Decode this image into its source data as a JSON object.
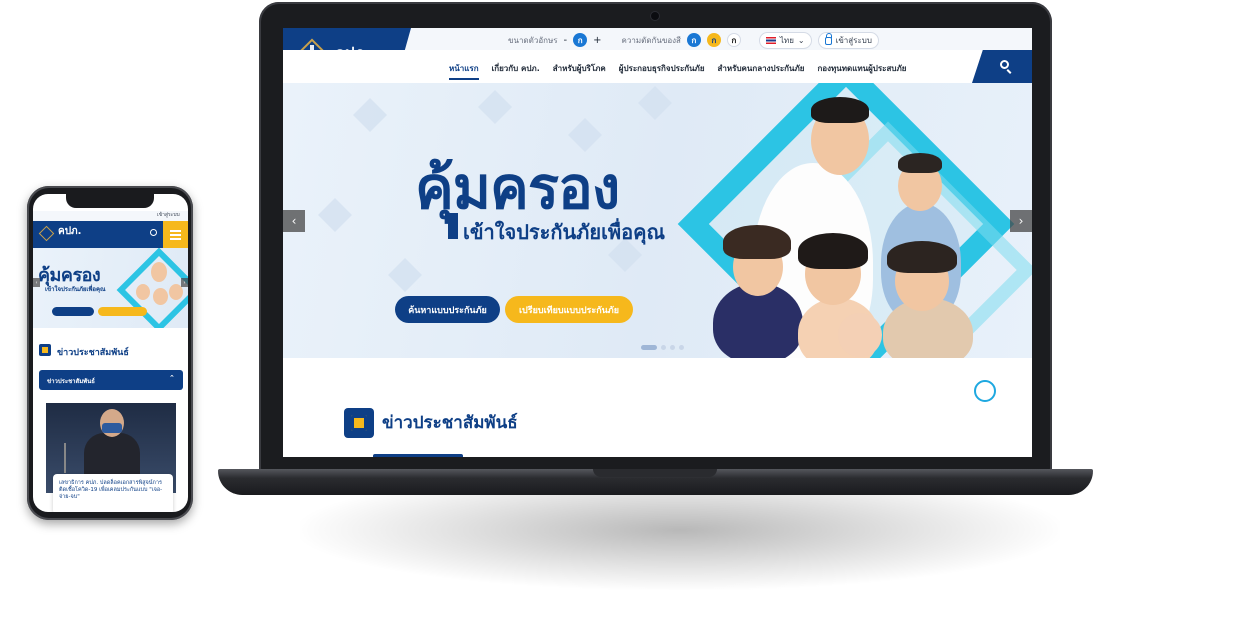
{
  "desktop": {
    "logo": {
      "title": "คปภ.",
      "subtitle": "สำนักงานคณะกรรมการกำกับและส่งเสริมการประกอบธุรกิจประกันภัย"
    },
    "utility": {
      "font_size_label": "ขนาดตัวอักษร",
      "font_decrease": "-",
      "font_default": "ก",
      "font_increase": "+",
      "contrast_label": "ความตัดกันของสี",
      "contrast_options": [
        "ก",
        "ก",
        "ก"
      ],
      "language": "ไทย",
      "login": "เข้าสู่ระบบ"
    },
    "nav": [
      "หน้าแรก",
      "เกี่ยวกับ คปภ.",
      "สำหรับผู้บริโภค",
      "ผู้ประกอบธุรกิจประกันภัย",
      "สำหรับคนกลางประกันภัย",
      "กองทุนทดแทนผู้ประสบภัย"
    ],
    "hero": {
      "title": "คุ้มครอง",
      "subtitle": "เข้าใจประกันภัยเพื่อคุณ",
      "primary_button": "ค้นหาแบบประกันภัย",
      "secondary_button": "เปรียบเทียบแบบประกันภัย",
      "prev": "‹",
      "next": "›"
    },
    "news_section_title": "ข่าวประชาสัมพันธ์"
  },
  "mobile": {
    "login": "เข้าสู่ระบบ",
    "logo_title": "คปภ.",
    "hero_title": "คุ้มครอง",
    "hero_subtitle": "เข้าใจประกันภัยเพื่อคุณ",
    "news_section_title": "ข่าวประชาสัมพันธ์",
    "accordion_label": "ข่าวประชาสัมพันธ์",
    "news_card_text": "เลขาธิการ คปภ. ปลดล็อคเอกสารพิสูจน์การติดเชื้อโควิด-19 เพื่อเคลมประกันแบบ \"เจอ-จ่าย-จบ\""
  },
  "colors": {
    "navy": "#0e3f86",
    "gold": "#f6b81c",
    "cyan": "#2cc4e4"
  }
}
